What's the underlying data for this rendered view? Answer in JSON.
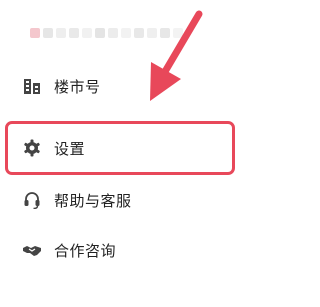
{
  "menu": {
    "items": [
      {
        "id": "building",
        "label": "楼市号",
        "icon": "building-icon"
      },
      {
        "id": "settings",
        "label": "设置",
        "icon": "gear-icon"
      },
      {
        "id": "help",
        "label": "帮助与客服",
        "icon": "headset-icon"
      },
      {
        "id": "coop",
        "label": "合作咨询",
        "icon": "handshake-icon"
      }
    ]
  },
  "annotation": {
    "highlight_target": "settings",
    "highlight_color": "#e8485a",
    "arrow_color": "#e8485a"
  },
  "colors": {
    "text": "#222222",
    "icon": "#444444",
    "blurred_username": [
      "#f4c7cd",
      "#e6e6e6",
      "#eeeeee",
      "#e9e9e9",
      "#f1f1f1",
      "#e4e4e4",
      "#ececec",
      "#f2f2f2",
      "#e8e8e8",
      "#efefef",
      "#e7e7e7",
      "#f3f3f3"
    ]
  }
}
